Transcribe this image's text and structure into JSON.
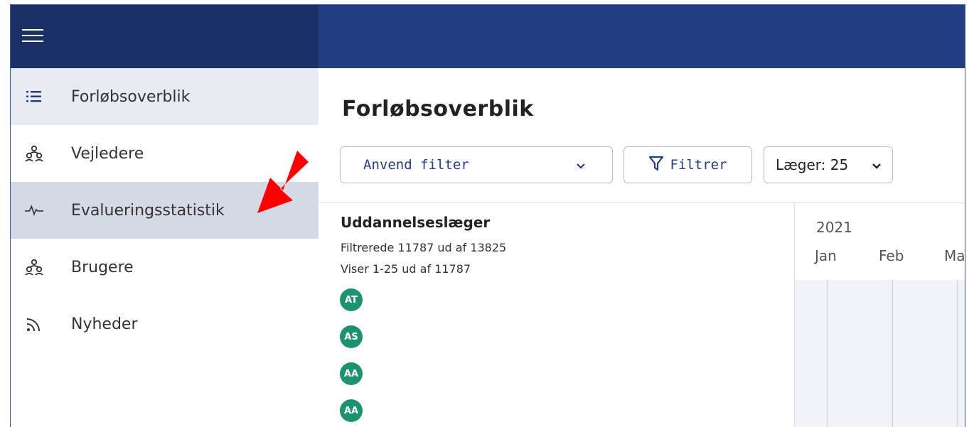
{
  "sidebar": {
    "items": [
      {
        "label": "Forløbsoverblik",
        "icon": "list-icon"
      },
      {
        "label": "Vejledere",
        "icon": "users-icon"
      },
      {
        "label": "Evalueringsstatistik",
        "icon": "pulse-icon"
      },
      {
        "label": "Brugere",
        "icon": "users-icon"
      },
      {
        "label": "Nyheder",
        "icon": "rss-icon"
      }
    ]
  },
  "main": {
    "title": "Forløbsoverblik",
    "filter_select": "Anvend filter",
    "filter_button": "Filtrer",
    "laeger_select": "Læger: 25",
    "list": {
      "title": "Uddannelseslæger",
      "filtered": "Filtrerede 11787 ud af 13825",
      "showing": "Viser 1-25 ud af 11787",
      "avatars": [
        "AT",
        "AS",
        "AA",
        "AA"
      ]
    },
    "timeline": {
      "year": "2021",
      "months": [
        "Jan",
        "Feb",
        "Ma"
      ]
    }
  },
  "colors": {
    "sidebar_header": "#1c3068",
    "topbar": "#233e83",
    "avatar": "#1b9270",
    "accent_text": "#233e83",
    "annotation_arrow": "#ff0000"
  }
}
